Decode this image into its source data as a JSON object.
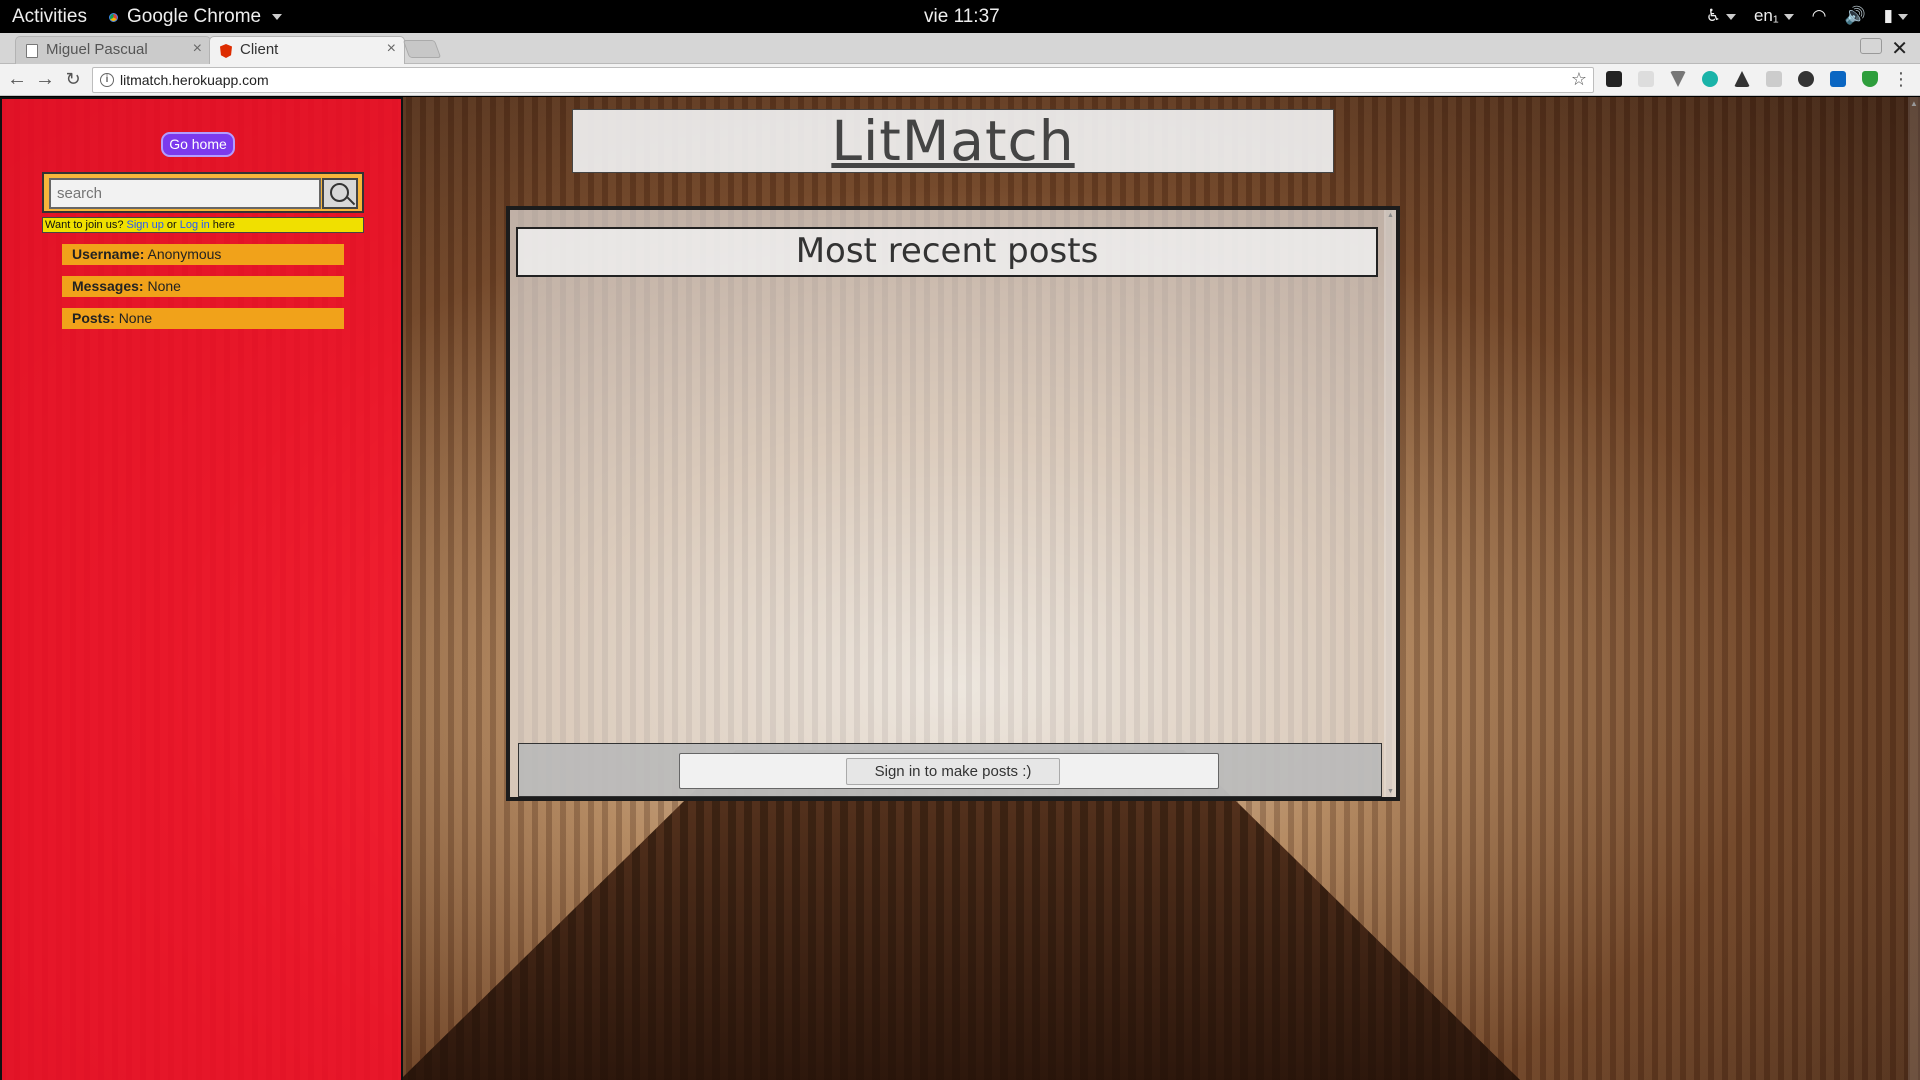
{
  "system_bar": {
    "activities": "Activities",
    "app_menu": "Google Chrome",
    "clock": "vie 11:37",
    "input_source": "en₁"
  },
  "browser": {
    "tabs": [
      {
        "label": "Miguel Pascual",
        "icon": "document-icon",
        "active": false
      },
      {
        "label": "Client",
        "icon": "angular-icon",
        "active": true
      }
    ],
    "url": "litmatch.herokuapp.com"
  },
  "sidebar": {
    "go_home": "Go home",
    "search_placeholder": "search",
    "join": {
      "prefix": "Want to join us?",
      "sign_up": "Sign up",
      "or": "or",
      "log_in": "Log in",
      "suffix": "here"
    },
    "info": [
      {
        "label": "Username:",
        "value": "Anonymous"
      },
      {
        "label": "Messages:",
        "value": "None"
      },
      {
        "label": "Posts:",
        "value": "None"
      }
    ]
  },
  "main": {
    "title": "LitMatch",
    "posts_header": "Most recent posts",
    "signin_button": "Sign in to make posts :)"
  },
  "colors": {
    "sidebar_bg": "#ff0e2a",
    "go_home_bg": "#7c3aed",
    "search_frame": "#f7b53b",
    "join_bar": "#f0e000",
    "info_row": "#f1a21a",
    "link": "#2458ff"
  }
}
